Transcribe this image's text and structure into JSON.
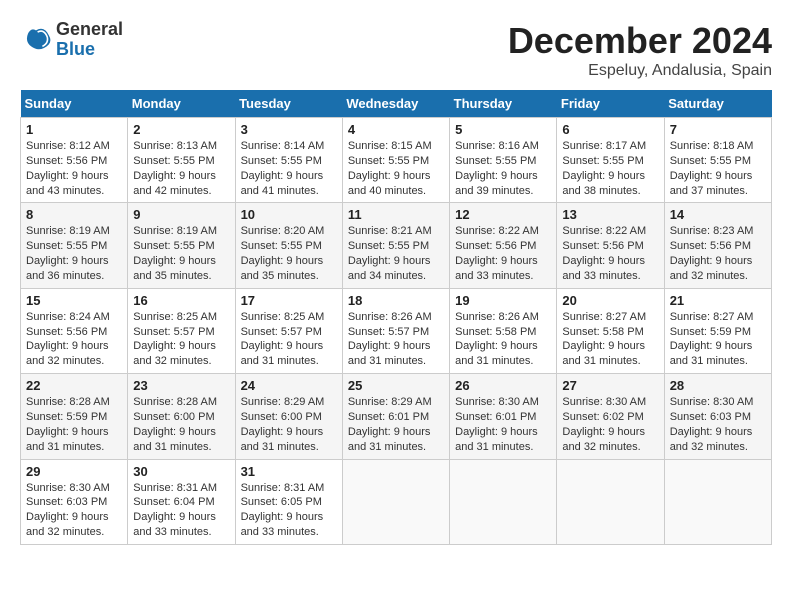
{
  "header": {
    "logo_general": "General",
    "logo_blue": "Blue",
    "month_title": "December 2024",
    "location": "Espeluy, Andalusia, Spain"
  },
  "days_of_week": [
    "Sunday",
    "Monday",
    "Tuesday",
    "Wednesday",
    "Thursday",
    "Friday",
    "Saturday"
  ],
  "weeks": [
    [
      {
        "day": "1",
        "info": "Sunrise: 8:12 AM\nSunset: 5:56 PM\nDaylight: 9 hours and 43 minutes."
      },
      {
        "day": "2",
        "info": "Sunrise: 8:13 AM\nSunset: 5:55 PM\nDaylight: 9 hours and 42 minutes."
      },
      {
        "day": "3",
        "info": "Sunrise: 8:14 AM\nSunset: 5:55 PM\nDaylight: 9 hours and 41 minutes."
      },
      {
        "day": "4",
        "info": "Sunrise: 8:15 AM\nSunset: 5:55 PM\nDaylight: 9 hours and 40 minutes."
      },
      {
        "day": "5",
        "info": "Sunrise: 8:16 AM\nSunset: 5:55 PM\nDaylight: 9 hours and 39 minutes."
      },
      {
        "day": "6",
        "info": "Sunrise: 8:17 AM\nSunset: 5:55 PM\nDaylight: 9 hours and 38 minutes."
      },
      {
        "day": "7",
        "info": "Sunrise: 8:18 AM\nSunset: 5:55 PM\nDaylight: 9 hours and 37 minutes."
      }
    ],
    [
      {
        "day": "8",
        "info": "Sunrise: 8:19 AM\nSunset: 5:55 PM\nDaylight: 9 hours and 36 minutes."
      },
      {
        "day": "9",
        "info": "Sunrise: 8:19 AM\nSunset: 5:55 PM\nDaylight: 9 hours and 35 minutes."
      },
      {
        "day": "10",
        "info": "Sunrise: 8:20 AM\nSunset: 5:55 PM\nDaylight: 9 hours and 35 minutes."
      },
      {
        "day": "11",
        "info": "Sunrise: 8:21 AM\nSunset: 5:55 PM\nDaylight: 9 hours and 34 minutes."
      },
      {
        "day": "12",
        "info": "Sunrise: 8:22 AM\nSunset: 5:56 PM\nDaylight: 9 hours and 33 minutes."
      },
      {
        "day": "13",
        "info": "Sunrise: 8:22 AM\nSunset: 5:56 PM\nDaylight: 9 hours and 33 minutes."
      },
      {
        "day": "14",
        "info": "Sunrise: 8:23 AM\nSunset: 5:56 PM\nDaylight: 9 hours and 32 minutes."
      }
    ],
    [
      {
        "day": "15",
        "info": "Sunrise: 8:24 AM\nSunset: 5:56 PM\nDaylight: 9 hours and 32 minutes."
      },
      {
        "day": "16",
        "info": "Sunrise: 8:25 AM\nSunset: 5:57 PM\nDaylight: 9 hours and 32 minutes."
      },
      {
        "day": "17",
        "info": "Sunrise: 8:25 AM\nSunset: 5:57 PM\nDaylight: 9 hours and 31 minutes."
      },
      {
        "day": "18",
        "info": "Sunrise: 8:26 AM\nSunset: 5:57 PM\nDaylight: 9 hours and 31 minutes."
      },
      {
        "day": "19",
        "info": "Sunrise: 8:26 AM\nSunset: 5:58 PM\nDaylight: 9 hours and 31 minutes."
      },
      {
        "day": "20",
        "info": "Sunrise: 8:27 AM\nSunset: 5:58 PM\nDaylight: 9 hours and 31 minutes."
      },
      {
        "day": "21",
        "info": "Sunrise: 8:27 AM\nSunset: 5:59 PM\nDaylight: 9 hours and 31 minutes."
      }
    ],
    [
      {
        "day": "22",
        "info": "Sunrise: 8:28 AM\nSunset: 5:59 PM\nDaylight: 9 hours and 31 minutes."
      },
      {
        "day": "23",
        "info": "Sunrise: 8:28 AM\nSunset: 6:00 PM\nDaylight: 9 hours and 31 minutes."
      },
      {
        "day": "24",
        "info": "Sunrise: 8:29 AM\nSunset: 6:00 PM\nDaylight: 9 hours and 31 minutes."
      },
      {
        "day": "25",
        "info": "Sunrise: 8:29 AM\nSunset: 6:01 PM\nDaylight: 9 hours and 31 minutes."
      },
      {
        "day": "26",
        "info": "Sunrise: 8:30 AM\nSunset: 6:01 PM\nDaylight: 9 hours and 31 minutes."
      },
      {
        "day": "27",
        "info": "Sunrise: 8:30 AM\nSunset: 6:02 PM\nDaylight: 9 hours and 32 minutes."
      },
      {
        "day": "28",
        "info": "Sunrise: 8:30 AM\nSunset: 6:03 PM\nDaylight: 9 hours and 32 minutes."
      }
    ],
    [
      {
        "day": "29",
        "info": "Sunrise: 8:30 AM\nSunset: 6:03 PM\nDaylight: 9 hours and 32 minutes."
      },
      {
        "day": "30",
        "info": "Sunrise: 8:31 AM\nSunset: 6:04 PM\nDaylight: 9 hours and 33 minutes."
      },
      {
        "day": "31",
        "info": "Sunrise: 8:31 AM\nSunset: 6:05 PM\nDaylight: 9 hours and 33 minutes."
      },
      null,
      null,
      null,
      null
    ]
  ]
}
